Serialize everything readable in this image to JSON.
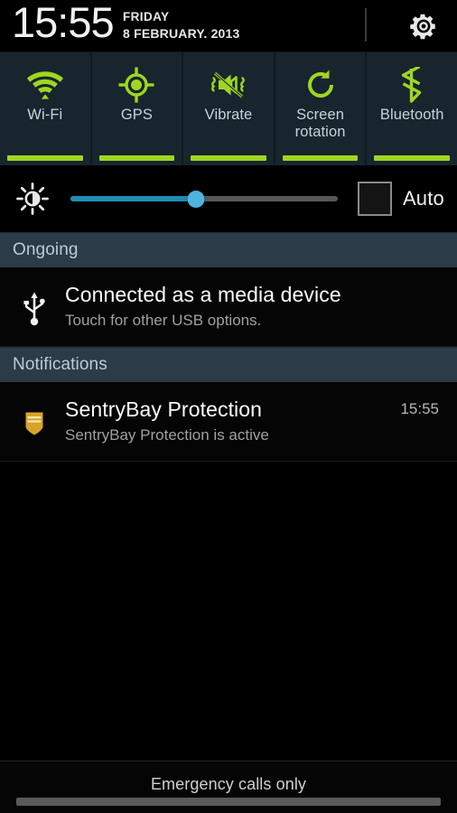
{
  "statusbar": {
    "clock": "15:55",
    "day_of_week": "FRIDAY",
    "date": "8 FEBRUARY. 2013",
    "settings_icon": "gear-icon"
  },
  "quick_toggles": [
    {
      "label": "Wi-Fi",
      "icon": "wifi-icon",
      "enabled": true
    },
    {
      "label": "GPS",
      "icon": "gps-crosshair-icon",
      "enabled": true
    },
    {
      "label": "Vibrate",
      "icon": "vibrate-muted-icon",
      "enabled": true
    },
    {
      "label": "Screen\nrotation",
      "icon": "screen-rotation-icon",
      "enabled": true
    },
    {
      "label": "Bluetooth",
      "icon": "bluetooth-icon",
      "enabled": true
    }
  ],
  "toggle_labels": {
    "wifi": "Wi-Fi",
    "gps": "GPS",
    "vibrate": "Vibrate",
    "rotation_line1": "Screen",
    "rotation_line2": "rotation",
    "bluetooth": "Bluetooth"
  },
  "brightness": {
    "icon": "brightness-sun-icon",
    "value_percent": 47,
    "auto_label": "Auto",
    "auto_checked": false
  },
  "sections": {
    "ongoing_header": "Ongoing",
    "notifications_header": "Notifications"
  },
  "ongoing": [
    {
      "icon": "usb-icon",
      "title": "Connected as a media device",
      "subtitle": "Touch for other USB options.",
      "time": ""
    }
  ],
  "notifications": [
    {
      "icon": "shield-icon",
      "title": "SentryBay Protection",
      "subtitle": "SentryBay Protection is active",
      "time": "15:55"
    }
  ],
  "bottom": {
    "carrier_status": "Emergency calls only",
    "handle": "drag-handle"
  },
  "colors": {
    "accent_green": "#9fd621",
    "slider_fill": "#1e8cb4",
    "slider_thumb": "#4db4dd",
    "toggle_bg": "#18252e",
    "section_header_bg": "#2b3b47",
    "shield_gold": "#d8a32a"
  }
}
